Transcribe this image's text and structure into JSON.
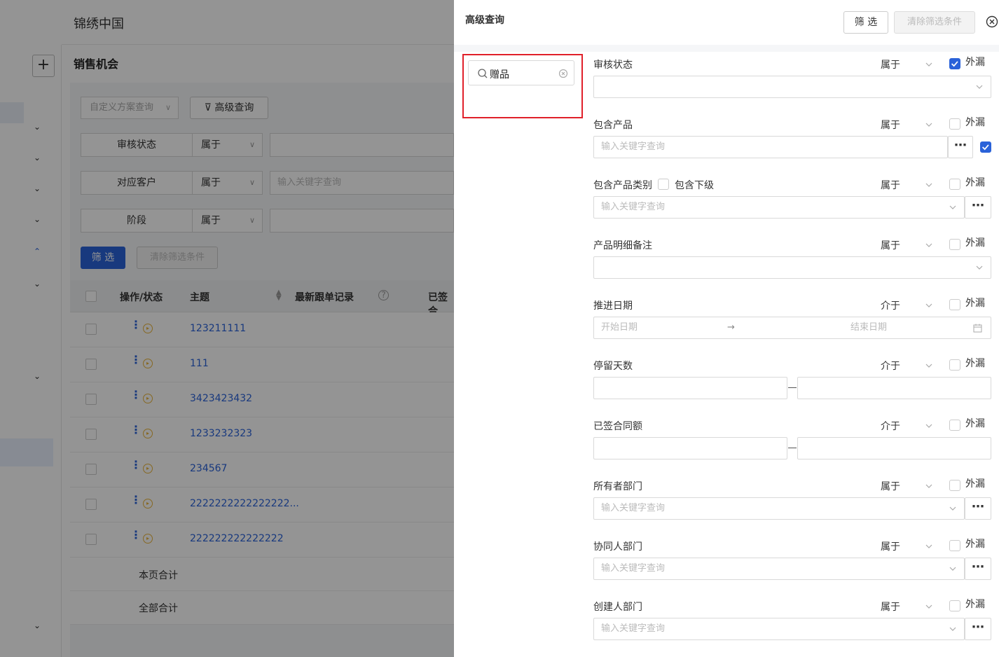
{
  "app_title": "锦绣中国",
  "page_title": "销售机会",
  "toolbar": {
    "scheme_placeholder": "自定义方案查询",
    "advanced_query": "高级查询",
    "filter": "筛 选",
    "clear": "清除筛选条件"
  },
  "bg_filters": [
    {
      "label": "审核状态",
      "op": "属于",
      "placeholder": ""
    },
    {
      "label": "对应客户",
      "op": "属于",
      "placeholder": "输入关键字查询"
    },
    {
      "label": "阶段",
      "op": "属于",
      "placeholder": ""
    }
  ],
  "table": {
    "headers": [
      "操作/状态",
      "主题",
      "最新跟单记录",
      "已签合"
    ],
    "rows": [
      "123211111",
      "111",
      "3423423432",
      "1233232323",
      "234567",
      "2222222222222222...",
      "222222222222222"
    ],
    "page_total": "本页合计",
    "all_total": "全部合计"
  },
  "drawer": {
    "title": "高级查询",
    "filter_button": "筛 选",
    "clear_button": "清除筛选条件",
    "search_value": "赠品",
    "include_sub_label": "包含下级",
    "exclude_label": "外漏",
    "date_start": "开始日期",
    "date_end": "结束日期",
    "fields": [
      {
        "label": "审核状态",
        "op": "属于",
        "excluded": true,
        "input": "select",
        "placeholder": ""
      },
      {
        "label": "包含产品",
        "op": "属于",
        "excluded": false,
        "input": "text-more",
        "placeholder": "输入关键字查询"
      },
      {
        "label": "包含产品类别",
        "op": "属于",
        "excluded": false,
        "input": "select-more",
        "placeholder": "输入关键字查询"
      },
      {
        "label": "产品明细备注",
        "op": "属于",
        "excluded": false,
        "input": "select",
        "placeholder": ""
      },
      {
        "label": "推进日期",
        "op": "介于",
        "excluded": false,
        "input": "date-range",
        "placeholder": ""
      },
      {
        "label": "停留天数",
        "op": "介于",
        "excluded": false,
        "input": "range",
        "placeholder": ""
      },
      {
        "label": "已签合同额",
        "op": "介于",
        "excluded": false,
        "input": "range",
        "placeholder": ""
      },
      {
        "label": "所有者部门",
        "op": "属于",
        "excluded": false,
        "input": "select-more",
        "placeholder": "输入关键字查询"
      },
      {
        "label": "协同人部门",
        "op": "属于",
        "excluded": false,
        "input": "select-more",
        "placeholder": "输入关键字查询"
      },
      {
        "label": "创建人部门",
        "op": "属于",
        "excluded": false,
        "input": "select-more",
        "placeholder": "输入关键字查询"
      }
    ],
    "product_extra_checked": true
  }
}
